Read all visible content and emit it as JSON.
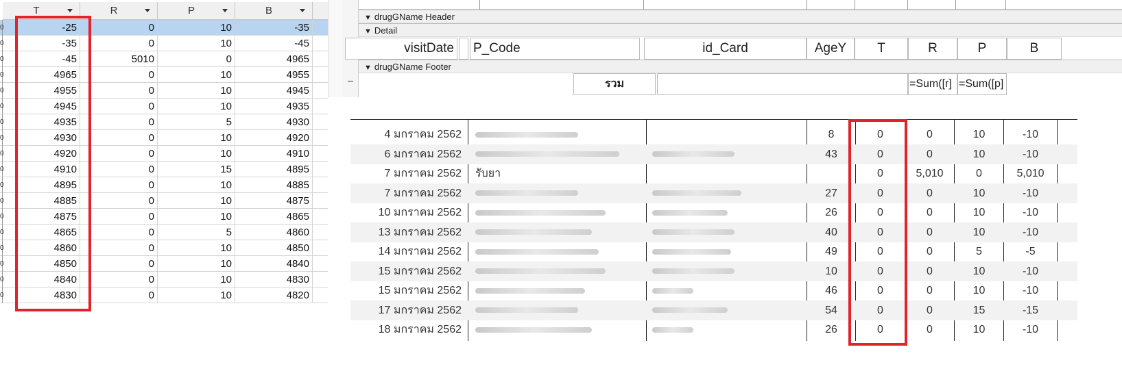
{
  "datasheet": {
    "columns": [
      "T",
      "R",
      "P",
      "B"
    ],
    "rows": [
      [
        "-25",
        "0",
        "10",
        "-35"
      ],
      [
        "-35",
        "0",
        "10",
        "-45"
      ],
      [
        "-45",
        "5010",
        "0",
        "4965"
      ],
      [
        "4965",
        "0",
        "10",
        "4955"
      ],
      [
        "4955",
        "0",
        "10",
        "4945"
      ],
      [
        "4945",
        "0",
        "10",
        "4935"
      ],
      [
        "4935",
        "0",
        "5",
        "4930"
      ],
      [
        "4930",
        "0",
        "10",
        "4920"
      ],
      [
        "4920",
        "0",
        "10",
        "4910"
      ],
      [
        "4910",
        "0",
        "15",
        "4895"
      ],
      [
        "4895",
        "0",
        "10",
        "4885"
      ],
      [
        "4885",
        "0",
        "10",
        "4875"
      ],
      [
        "4875",
        "0",
        "10",
        "4865"
      ],
      [
        "4865",
        "0",
        "5",
        "4860"
      ],
      [
        "4860",
        "0",
        "10",
        "4850"
      ],
      [
        "4850",
        "0",
        "10",
        "4840"
      ],
      [
        "4840",
        "0",
        "10",
        "4830"
      ],
      [
        "4830",
        "0",
        "10",
        "4820"
      ]
    ]
  },
  "design": {
    "header_band": "drugGName Header",
    "detail_band": "Detail",
    "footer_band": "drugGName Footer",
    "detail_fields": [
      "visitDate",
      "P_Code",
      "id_Card",
      "AgeY",
      "T",
      "R",
      "P",
      "B"
    ],
    "footer_label": "รวม",
    "footer_sum_r": "=Sum([r]",
    "footer_sum_p": "=Sum([p]"
  },
  "report": {
    "rows": [
      {
        "date": "4 มกราคม 2562",
        "name": "",
        "id": "",
        "age": "8",
        "t": "0",
        "r": "0",
        "p": "10",
        "b": "-10"
      },
      {
        "date": "6 มกราคม 2562",
        "name": "",
        "id": "",
        "age": "43",
        "t": "0",
        "r": "0",
        "p": "10",
        "b": "-10"
      },
      {
        "date": "7 มกราคม 2562",
        "name": "รับยา",
        "id": "",
        "age": "",
        "t": "0",
        "r": "5,010",
        "p": "0",
        "b": "5,010"
      },
      {
        "date": "7 มกราคม 2562",
        "name": "",
        "id": "",
        "age": "27",
        "t": "0",
        "r": "0",
        "p": "10",
        "b": "-10"
      },
      {
        "date": "10 มกราคม 2562",
        "name": "",
        "id": "",
        "age": "26",
        "t": "0",
        "r": "0",
        "p": "10",
        "b": "-10"
      },
      {
        "date": "13 มกราคม 2562",
        "name": "",
        "id": "",
        "age": "40",
        "t": "0",
        "r": "0",
        "p": "10",
        "b": "-10"
      },
      {
        "date": "14 มกราคม 2562",
        "name": "",
        "id": "",
        "age": "49",
        "t": "0",
        "r": "0",
        "p": "5",
        "b": "-5"
      },
      {
        "date": "15 มกราคม 2562",
        "name": "",
        "id": "",
        "age": "10",
        "t": "0",
        "r": "0",
        "p": "10",
        "b": "-10"
      },
      {
        "date": "15 มกราคม 2562",
        "name": "",
        "id": "",
        "age": "46",
        "t": "0",
        "r": "0",
        "p": "10",
        "b": "-10"
      },
      {
        "date": "17 มกราคม 2562",
        "name": "",
        "id": "",
        "age": "54",
        "t": "0",
        "r": "0",
        "p": "15",
        "b": "-15"
      },
      {
        "date": "18 มกราคม 2562",
        "name": "",
        "id": "",
        "age": "26",
        "t": "0",
        "r": "0",
        "p": "10",
        "b": "-10"
      }
    ]
  },
  "colors": {
    "highlight_box": "#e0242c",
    "selected_row": "#b8d4f1"
  }
}
